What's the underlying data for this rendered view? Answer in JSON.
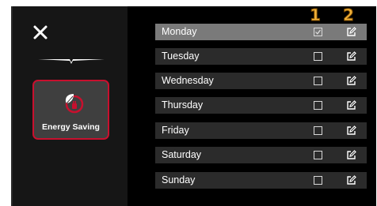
{
  "sidebar": {
    "close_icon": "close-icon",
    "mode": {
      "label": "Energy Saving",
      "icon": "energy-saving-icon",
      "accent": "#c8102e"
    }
  },
  "columns": {
    "marker_1": "1",
    "marker_2": "2",
    "marker_color": "#f2b23a"
  },
  "days": [
    {
      "label": "Monday",
      "checked": true,
      "active": true
    },
    {
      "label": "Tuesday",
      "checked": false,
      "active": false
    },
    {
      "label": "Wednesday",
      "checked": false,
      "active": false
    },
    {
      "label": "Thursday",
      "checked": false,
      "active": false
    },
    {
      "label": "Friday",
      "checked": false,
      "active": false
    },
    {
      "label": "Saturday",
      "checked": false,
      "active": false
    },
    {
      "label": "Sunday",
      "checked": false,
      "active": false
    }
  ]
}
